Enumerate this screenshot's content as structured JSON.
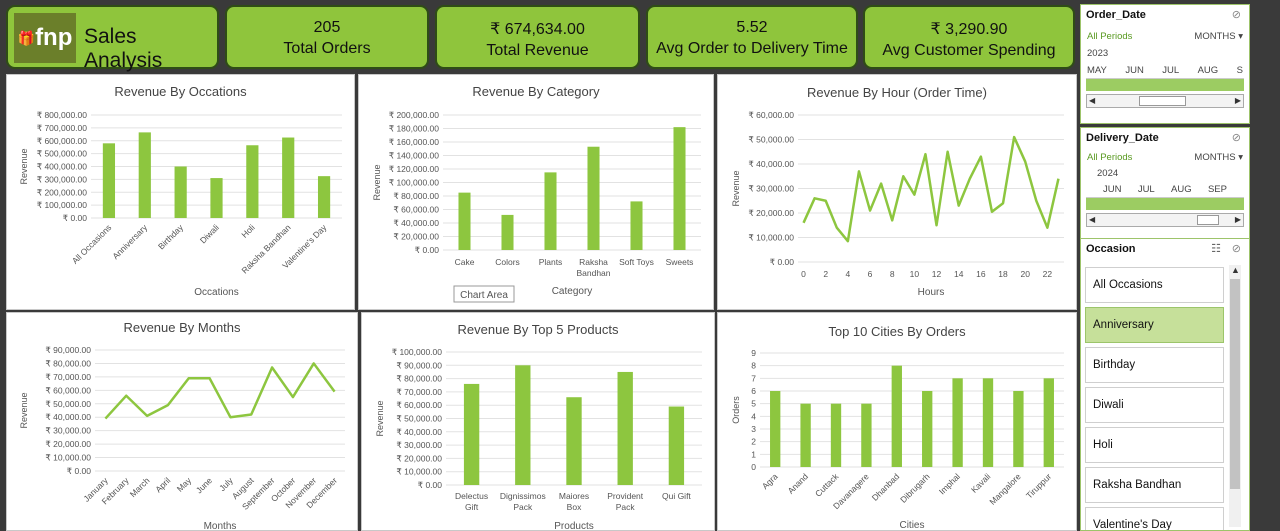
{
  "brand": {
    "logo_text": "fnp",
    "title": "Sales Analysis"
  },
  "kpis": [
    {
      "value": "205",
      "label": "Total Orders"
    },
    {
      "value": "₹ 674,634.00",
      "label": "Total Revenue"
    },
    {
      "value": "5.52",
      "label": "Avg Order to Delivery Time"
    },
    {
      "value": "₹ 3,290.90",
      "label": "Avg Customer Spending"
    }
  ],
  "colors": {
    "bar": "#8dc63f",
    "kpi_bg": "#8fc53c",
    "slicer_sel": "#c6e09a"
  },
  "charts": {
    "occasions": {
      "title": "Revenue By Occations",
      "xlabel": "Occations",
      "ylabel": "Revenue",
      "yticks": [
        "₹ 800,000.00",
        "₹ 700,000.00",
        "₹ 600,000.00",
        "₹ 500,000.00",
        "₹ 400,000.00",
        "₹ 300,000.00",
        "₹ 200,000.00",
        "₹ 100,000.00",
        "₹ 0.00"
      ]
    },
    "category": {
      "title": "Revenue By Category",
      "xlabel": "Category",
      "ylabel": "Revenue",
      "tooltip": "Chart Area",
      "yticks": [
        "₹ 200,000.00",
        "₹ 180,000.00",
        "₹ 160,000.00",
        "₹ 140,000.00",
        "₹ 120,000.00",
        "₹ 100,000.00",
        "₹ 80,000.00",
        "₹ 60,000.00",
        "₹ 40,000.00",
        "₹ 20,000.00",
        "₹ 0.00"
      ]
    },
    "hour": {
      "title": "Revenue By Hour (Order Time)",
      "xlabel": "Hours",
      "ylabel": "Revenue",
      "yticks": [
        "₹ 60,000.00",
        "₹ 50,000.00",
        "₹ 40,000.00",
        "₹ 30,000.00",
        "₹ 20,000.00",
        "₹ 10,000.00",
        "₹ 0.00"
      ]
    },
    "months": {
      "title": "Revenue By Months",
      "xlabel": "Months",
      "ylabel": "Revenue",
      "yticks": [
        "₹ 90,000.00",
        "₹ 80,000.00",
        "₹ 70,000.00",
        "₹ 60,000.00",
        "₹ 50,000.00",
        "₹ 40,000.00",
        "₹ 30,000.00",
        "₹ 20,000.00",
        "₹ 10,000.00",
        "₹ 0.00"
      ]
    },
    "products": {
      "title": "Revenue By Top 5 Products",
      "xlabel": "Products",
      "ylabel": "Revenue",
      "yticks": [
        "₹ 100,000.00",
        "₹ 90,000.00",
        "₹ 80,000.00",
        "₹ 70,000.00",
        "₹ 60,000.00",
        "₹ 50,000.00",
        "₹ 40,000.00",
        "₹ 30,000.00",
        "₹ 20,000.00",
        "₹ 10,000.00",
        "₹ 0.00"
      ]
    },
    "cities": {
      "title": "Top 10 Cities By Orders",
      "xlabel": "Cities",
      "ylabel": "Orders",
      "yticks": [
        "9",
        "8",
        "7",
        "6",
        "5",
        "4",
        "3",
        "2",
        "1",
        "0"
      ]
    }
  },
  "chart_data": [
    {
      "type": "bar",
      "title": "Revenue By Occations",
      "xlabel": "Occations",
      "ylabel": "Revenue",
      "ylim": [
        0,
        800000
      ],
      "categories": [
        "All Occasions",
        "Anniversary",
        "Birthday",
        "Diwali",
        "Holi",
        "Raksha Bandhan",
        "Valentine's Day"
      ],
      "values": [
        580000,
        665000,
        400000,
        310000,
        565000,
        625000,
        325000
      ]
    },
    {
      "type": "bar",
      "title": "Revenue By Category",
      "xlabel": "Category",
      "ylabel": "Revenue",
      "ylim": [
        0,
        200000
      ],
      "categories": [
        "Cake",
        "Colors",
        "Plants",
        "Raksha Bandhan",
        "Soft Toys",
        "Sweets"
      ],
      "values": [
        85000,
        52000,
        115000,
        153000,
        72000,
        182000
      ]
    },
    {
      "type": "line",
      "title": "Revenue By Hour (Order Time)",
      "xlabel": "Hours",
      "ylabel": "Revenue",
      "ylim": [
        0,
        60000
      ],
      "x": [
        0,
        1,
        2,
        3,
        4,
        5,
        6,
        7,
        8,
        9,
        10,
        11,
        12,
        13,
        14,
        15,
        16,
        17,
        18,
        19,
        20,
        21,
        22,
        23
      ],
      "values": [
        16000,
        26000,
        25000,
        14000,
        8500,
        37000,
        21000,
        32000,
        17000,
        35000,
        27500,
        44000,
        15000,
        45000,
        23000,
        34000,
        43000,
        20500,
        24000,
        51000,
        41000,
        25000,
        14000,
        34000
      ],
      "xticks": [
        "0",
        "2",
        "4",
        "6",
        "8",
        "10",
        "12",
        "14",
        "16",
        "18",
        "20",
        "22"
      ]
    },
    {
      "type": "line",
      "title": "Revenue By Months",
      "xlabel": "Months",
      "ylabel": "Revenue",
      "ylim": [
        0,
        90000
      ],
      "categories": [
        "January",
        "February",
        "March",
        "April",
        "May",
        "June",
        "July",
        "August",
        "September",
        "October",
        "November",
        "December"
      ],
      "values": [
        39000,
        56000,
        41000,
        49000,
        69000,
        69000,
        40000,
        42000,
        77000,
        55000,
        80000,
        59000
      ]
    },
    {
      "type": "bar",
      "title": "Revenue By Top 5 Products",
      "xlabel": "Products",
      "ylabel": "Revenue",
      "ylim": [
        0,
        100000
      ],
      "categories": [
        "Delectus Gift",
        "Dignissimos Pack",
        "Maiores Box",
        "Provident Pack",
        "Qui Gift"
      ],
      "values": [
        76000,
        90000,
        66000,
        85000,
        59000
      ]
    },
    {
      "type": "bar",
      "title": "Top 10 Cities By Orders",
      "xlabel": "Cities",
      "ylabel": "Orders",
      "ylim": [
        0,
        9
      ],
      "categories": [
        "Agra",
        "Anand",
        "Cuttack",
        "Davanagere",
        "Dhanbad",
        "Dibrugarh",
        "Imphal",
        "Kavali",
        "Mangalore",
        "Tiruppur"
      ],
      "values": [
        6,
        5,
        5,
        5,
        8,
        6,
        7,
        7,
        6,
        7
      ]
    }
  ],
  "slicers": {
    "order_date": {
      "title": "Order_Date",
      "all_periods": "All Periods",
      "unit": "MONTHS",
      "year": "2023",
      "months": [
        "MAY",
        "JUN",
        "JUL",
        "AUG",
        "S"
      ]
    },
    "delivery_date": {
      "title": "Delivery_Date",
      "all_periods": "All Periods",
      "unit": "MONTHS",
      "year": "2024",
      "months": [
        "JUN",
        "JUL",
        "AUG",
        "SEP"
      ]
    },
    "occasion": {
      "title": "Occasion",
      "items": [
        "All Occasions",
        "Anniversary",
        "Birthday",
        "Diwali",
        "Holi",
        "Raksha Bandhan",
        "Valentine's Day"
      ],
      "selected": "Anniversary"
    }
  }
}
